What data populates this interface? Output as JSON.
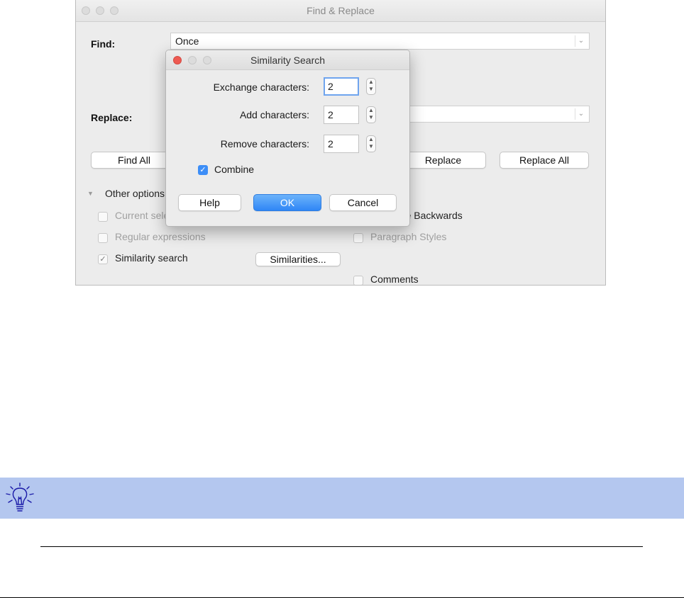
{
  "find_replace": {
    "window_title": "Find & Replace",
    "find_label": "Find:",
    "find_value": "Once",
    "replace_label": "Replace:",
    "replace_value": "",
    "find_all_label": "Find All",
    "replace_button_label": "Replace",
    "replace_all_label": "Replace All",
    "other_options_label": "Other options",
    "options": {
      "current_selection": "Current selection only",
      "regular_expressions": "Regular expressions",
      "similarity_search": "Similarity search",
      "similarities_button": "Similarities...",
      "search_backwards": "Replace Backwards",
      "paragraph_styles": "Paragraph Styles",
      "comments": "Comments"
    }
  },
  "similarity_dialog": {
    "title": "Similarity Search",
    "exchange_label": "Exchange characters:",
    "exchange_value": "2",
    "add_label": "Add characters:",
    "add_value": "2",
    "remove_label": "Remove characters:",
    "remove_value": "2",
    "combine_label": "Combine",
    "combine_checked": true,
    "help_label": "Help",
    "ok_label": "OK",
    "cancel_label": "Cancel"
  },
  "tip": {
    "icon": "lightbulb-icon",
    "background": "#b4c7ef"
  },
  "colors": {
    "close_button": "#ee5a52",
    "accent_blue": "#3d8ef7"
  }
}
